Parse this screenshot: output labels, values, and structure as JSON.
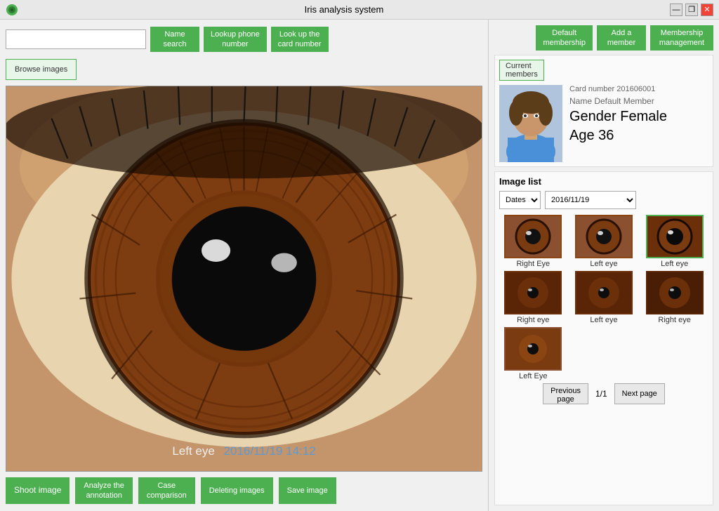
{
  "window": {
    "title": "Iris analysis system"
  },
  "toolbar": {
    "search_placeholder": "",
    "name_search": "Name\nsearch",
    "lookup_phone": "Lookup phone\nnumber",
    "lookup_card": "Look up the\ncard number"
  },
  "right_toolbar": {
    "default_membership": "Default\nmembership",
    "add_member": "Add a\nmember",
    "membership_management": "Membership\nmanagement"
  },
  "browse_btn": "Browse images",
  "image_overlay": {
    "label_eye": "Left eye",
    "label_date": "2016/11/19 14:12"
  },
  "bottom_toolbar": {
    "shoot_image": "Shoot image",
    "analyze_annotation": "Analyze the\nannotation",
    "case_comparison": "Case\ncomparison",
    "deleting_images": "Deleting images",
    "save_image": "Save image"
  },
  "member_section": {
    "label": "Current\nmembers",
    "card_number": "Card number 201606001",
    "name": "Name Default Member",
    "gender": "Gender Female",
    "age": "Age 36"
  },
  "image_list": {
    "label": "Image list",
    "dates_label": "Dates",
    "date_value": "2016/11/19",
    "thumbnails": [
      {
        "label": "Right Eye",
        "selected": false,
        "row": 0
      },
      {
        "label": "Left eye",
        "selected": false,
        "row": 0
      },
      {
        "label": "Left eye",
        "selected": true,
        "row": 0
      },
      {
        "label": "Right eye",
        "selected": false,
        "row": 1
      },
      {
        "label": "Left eye",
        "selected": false,
        "row": 1
      },
      {
        "label": "Right eye",
        "selected": false,
        "row": 1
      },
      {
        "label": "Left Eye",
        "selected": false,
        "row": 2
      }
    ]
  },
  "pagination": {
    "prev": "Previous\npage",
    "page_info": "1/1",
    "next": "Next page"
  }
}
